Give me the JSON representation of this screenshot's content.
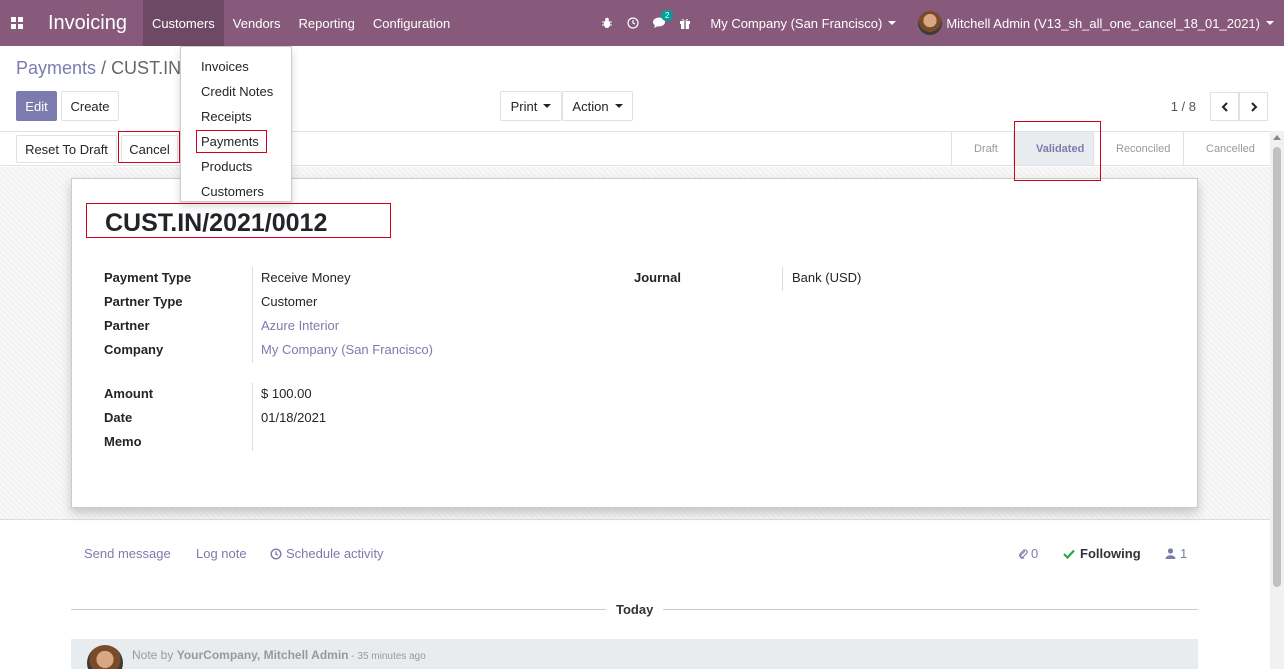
{
  "navbar": {
    "brand": "Invoicing",
    "menu": [
      "Customers",
      "Vendors",
      "Reporting",
      "Configuration"
    ],
    "messages_badge": "2",
    "company": "My Company (San Francisco)",
    "user": "Mitchell Admin (V13_sh_all_one_cancel_18_01_2021)"
  },
  "dropdown": {
    "items": [
      "Invoices",
      "Credit Notes",
      "Receipts",
      "Payments",
      "Products",
      "Customers"
    ]
  },
  "breadcrumb": {
    "parent": "Payments",
    "separator": " / ",
    "current": "CUST.IN"
  },
  "buttons": {
    "edit": "Edit",
    "create": "Create",
    "print": "Print",
    "action": "Action",
    "reset_to_draft": "Reset To Draft",
    "cancel": "Cancel"
  },
  "pager": {
    "value": "1 / 8"
  },
  "stages": [
    "Draft",
    "Validated",
    "Reconciled",
    "Cancelled"
  ],
  "active_stage": "Validated",
  "record": {
    "name": "CUST.IN/2021/0012",
    "left_fields": [
      {
        "label": "Payment Type",
        "value": "Receive Money",
        "link": false
      },
      {
        "label": "Partner Type",
        "value": "Customer",
        "link": false
      },
      {
        "label": "Partner",
        "value": "Azure Interior",
        "link": true
      },
      {
        "label": "Company",
        "value": "My Company (San Francisco)",
        "link": true
      }
    ],
    "left_fields2": [
      {
        "label": "Amount",
        "value": "$ 100.00"
      },
      {
        "label": "Date",
        "value": "01/18/2021"
      },
      {
        "label": "Memo",
        "value": ""
      }
    ],
    "journal_label": "Journal",
    "journal_value": "Bank (USD)"
  },
  "chatter": {
    "send_message": "Send message",
    "log_note": "Log note",
    "schedule_activity": "Schedule activity",
    "attachments_count": "0",
    "following": "Following",
    "followers_count": "1",
    "today": "Today",
    "note_prefix": "Note by",
    "note_author": "YourCompany, Mitchell Admin",
    "note_time": " - 35 minutes ago"
  },
  "colors": {
    "brand": "#875a7b",
    "accent": "#7c7bad",
    "highlight": "#d0021b",
    "following": "#28a745"
  }
}
